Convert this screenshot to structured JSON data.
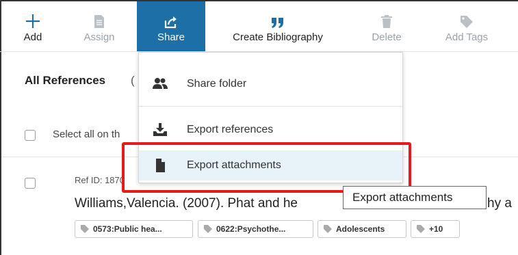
{
  "toolbar": {
    "add_label": "Add",
    "assign_label": "Assign",
    "share_label": "Share",
    "create_bibliography_label": "Create Bibliography",
    "delete_label": "Delete",
    "add_tags_label": "Add Tags",
    "active_color": "#1d6fa8"
  },
  "content": {
    "title": "All References",
    "title_count": "(",
    "select_all_label": "Select all on th",
    "reference": {
      "ref_id": "Ref ID: 1870",
      "citation": "Williams,Valencia. (2007). Phat and he",
      "citation_tail": "hy a",
      "tags": [
        "0573:Public hea...",
        "0622:Psychothe...",
        "Adolescents",
        "+10"
      ]
    }
  },
  "share_menu": {
    "items": [
      {
        "label": "Share folder",
        "icon": "people-icon"
      },
      {
        "label": "Export references",
        "icon": "download-tray-icon"
      },
      {
        "label": "Export attachments",
        "icon": "file-icon"
      }
    ]
  },
  "tooltip": {
    "text": "Export attachments"
  },
  "highlight_color": "#e31b1b"
}
